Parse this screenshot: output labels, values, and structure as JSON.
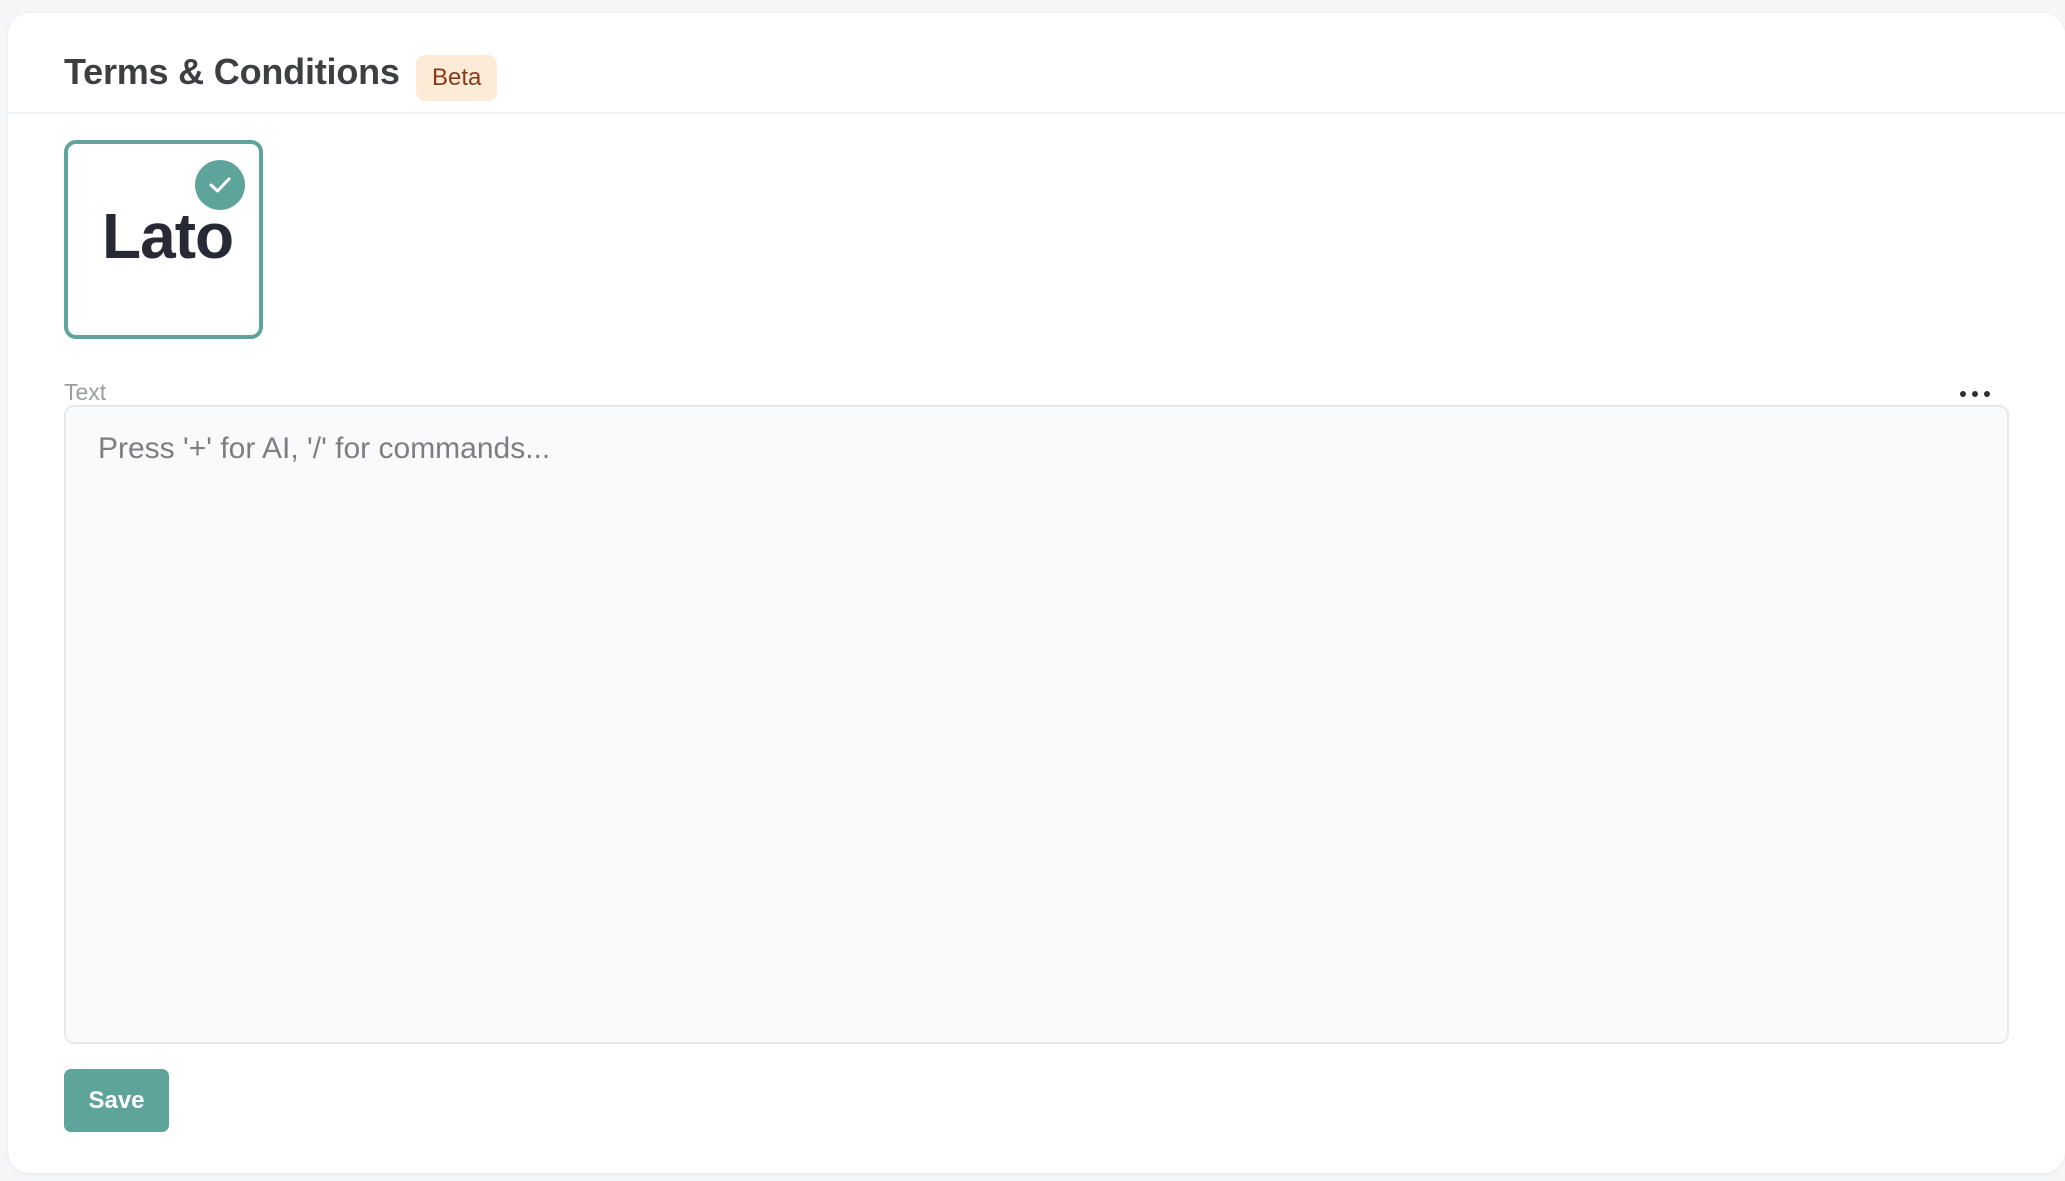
{
  "header": {
    "title": "Terms & Conditions",
    "badge": "Beta"
  },
  "font_option": {
    "label": "Lato",
    "selected": true,
    "icon": "check-circle-icon"
  },
  "field": {
    "label": "Text",
    "placeholder": "Press '+' for AI, '/' for commands...",
    "menu_icon": "more-horizontal-icon"
  },
  "actions": {
    "save_label": "Save"
  },
  "colors": {
    "accent": "#5fa49b",
    "badge_bg": "#fcebd7",
    "badge_text": "#8a3a18",
    "title_text": "#3d3f42"
  }
}
